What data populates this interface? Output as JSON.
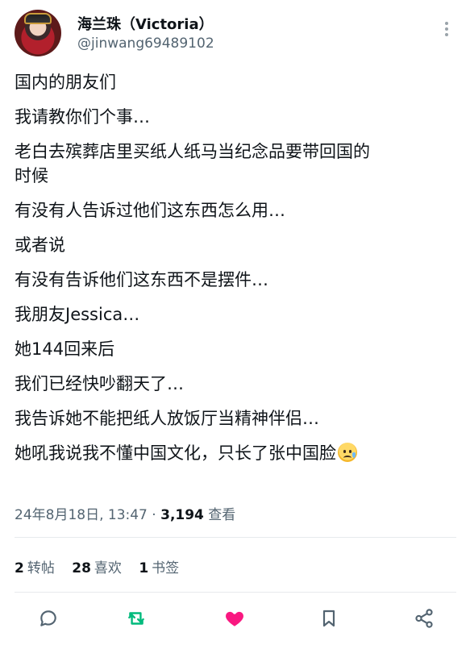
{
  "author": {
    "name": "海兰珠（Victoria）",
    "handle": "@jinwang69489102"
  },
  "tweet": {
    "lines": [
      "国内的朋友们",
      "我请教你们个事…",
      "老白去殡葬店里买纸人纸马当纪念品要带回国的",
      "时候",
      "有没有人告诉过他们这东西怎么用…",
      "或者说",
      "有没有告诉他们这东西不是摆件…",
      "我朋友Jessica…",
      "她144回来后",
      "我们已经快吵翻天了…",
      "我告诉她不能把纸人放饭厅当精神伴侣…",
      "她吼我说我不懂中国文化，只长了张中国脸"
    ],
    "emoji": "sad-but-relieved-face"
  },
  "meta": {
    "datetime": "24年8月18日, 13:47",
    "separator": " · ",
    "views_count": "3,194",
    "views_label": " 查看"
  },
  "stats": {
    "reposts_count": "2",
    "reposts_label": "转帖",
    "likes_count": "28",
    "likes_label": "喜欢",
    "bookmarks_count": "1",
    "bookmarks_label": "书签"
  },
  "actions": {
    "icons": [
      "reply-icon",
      "retweet-icon",
      "like-icon",
      "bookmark-icon",
      "share-icon"
    ],
    "colors": {
      "retweet": "#00ba7c",
      "like": "#f91880",
      "default": "#536471"
    }
  }
}
